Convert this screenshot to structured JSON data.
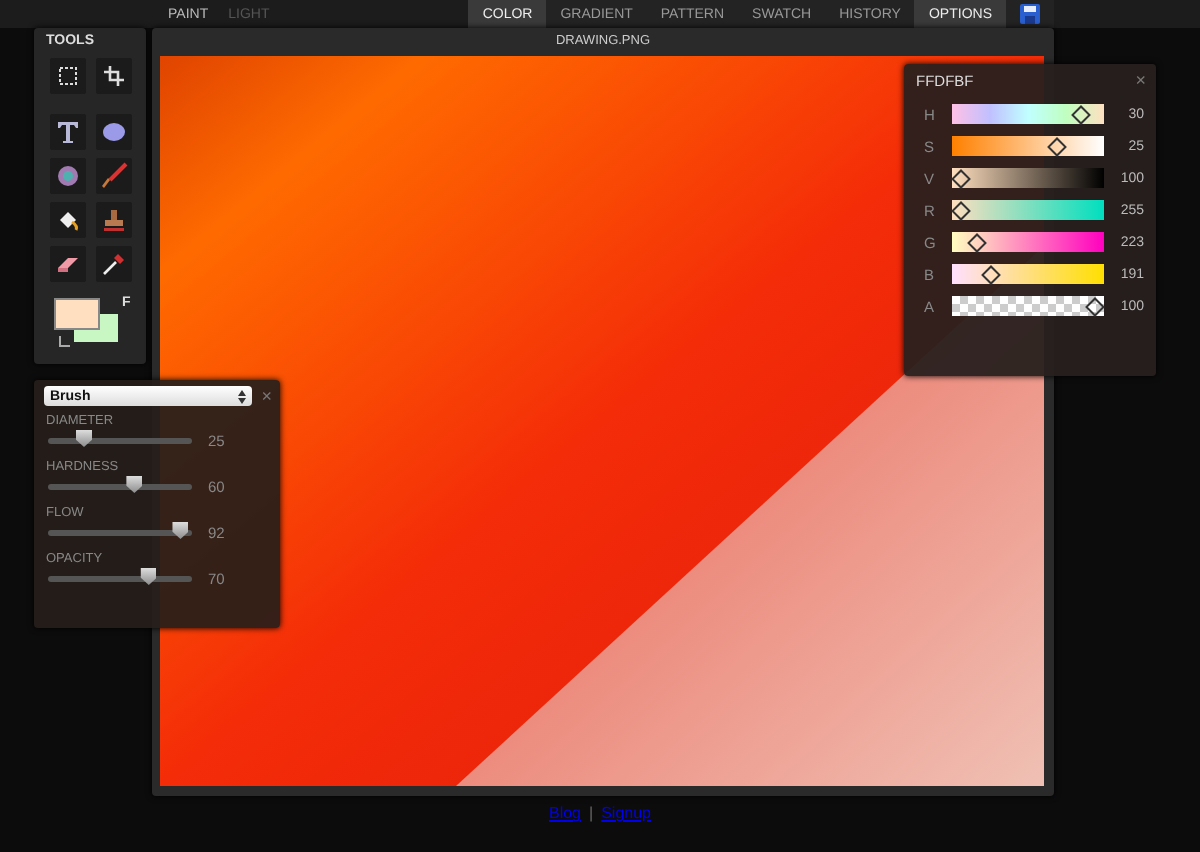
{
  "menu": [
    {
      "label": "PAINT",
      "disabled": false
    },
    {
      "label": "LIGHT",
      "disabled": true
    }
  ],
  "tabs": [
    {
      "label": "COLOR",
      "selected": true
    },
    {
      "label": "GRADIENT",
      "selected": false
    },
    {
      "label": "PATTERN",
      "selected": false
    },
    {
      "label": "SWATCH",
      "selected": false
    },
    {
      "label": "HISTORY",
      "selected": false
    },
    {
      "label": "OPTIONS",
      "selected": true
    }
  ],
  "tools": {
    "title": "TOOLS",
    "swatches": {
      "label": "F"
    }
  },
  "canvas": {
    "title": "DRAWING.PNG"
  },
  "brush": {
    "preset": "Brush",
    "close": "×",
    "sliders": [
      {
        "label": "DIAMETER",
        "level": 0.25,
        "reading": "25"
      },
      {
        "label": "HARDNESS",
        "level": 0.6,
        "reading": "60"
      },
      {
        "label": "FLOW",
        "level": 0.92,
        "reading": "92"
      },
      {
        "label": "OPACITY",
        "level": 0.7,
        "reading": "70"
      }
    ]
  },
  "color": {
    "hex": "FFDFBF",
    "close": "×",
    "channels": [
      {
        "label": "H",
        "level": 0.9,
        "reading": "30"
      },
      {
        "label": "S",
        "level": 0.72,
        "reading": "25"
      },
      {
        "label": "V",
        "level": 0,
        "reading": "100"
      },
      {
        "label": "R",
        "level": 0,
        "reading": "255"
      },
      {
        "label": "G",
        "level": 0.12,
        "reading": "223"
      },
      {
        "label": "B",
        "level": 0.23,
        "reading": "191"
      },
      {
        "label": "A",
        "level": 1,
        "reading": "100"
      }
    ]
  },
  "footer": {
    "links": [
      "Blog",
      "Signup"
    ],
    "separator": "|"
  }
}
